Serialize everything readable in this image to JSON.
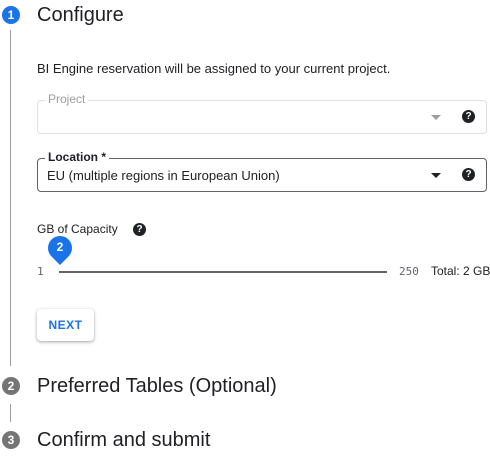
{
  "steps": [
    {
      "number": "1",
      "title": "Configure",
      "state": "active"
    },
    {
      "number": "2",
      "title": "Preferred Tables (Optional)",
      "state": "inactive"
    },
    {
      "number": "3",
      "title": "Confirm and submit",
      "state": "inactive"
    }
  ],
  "configure": {
    "description": "BI Engine reservation will be assigned to your current project.",
    "project": {
      "label": "Project",
      "value": "",
      "disabled": true
    },
    "location": {
      "label": "Location *",
      "value": "EU (multiple regions in European Union)"
    },
    "help_glyph": "?",
    "capacity": {
      "label": "GB of Capacity",
      "value": "2",
      "min": "1",
      "max": "250",
      "total_text": "Total: 2 GB"
    },
    "next_label": "NEXT"
  },
  "colors": {
    "active": "#1a73e8",
    "inactive": "#757575",
    "text": "#202124"
  },
  "icons": {
    "dropdown": "chevron-down-icon",
    "help": "help-icon"
  }
}
